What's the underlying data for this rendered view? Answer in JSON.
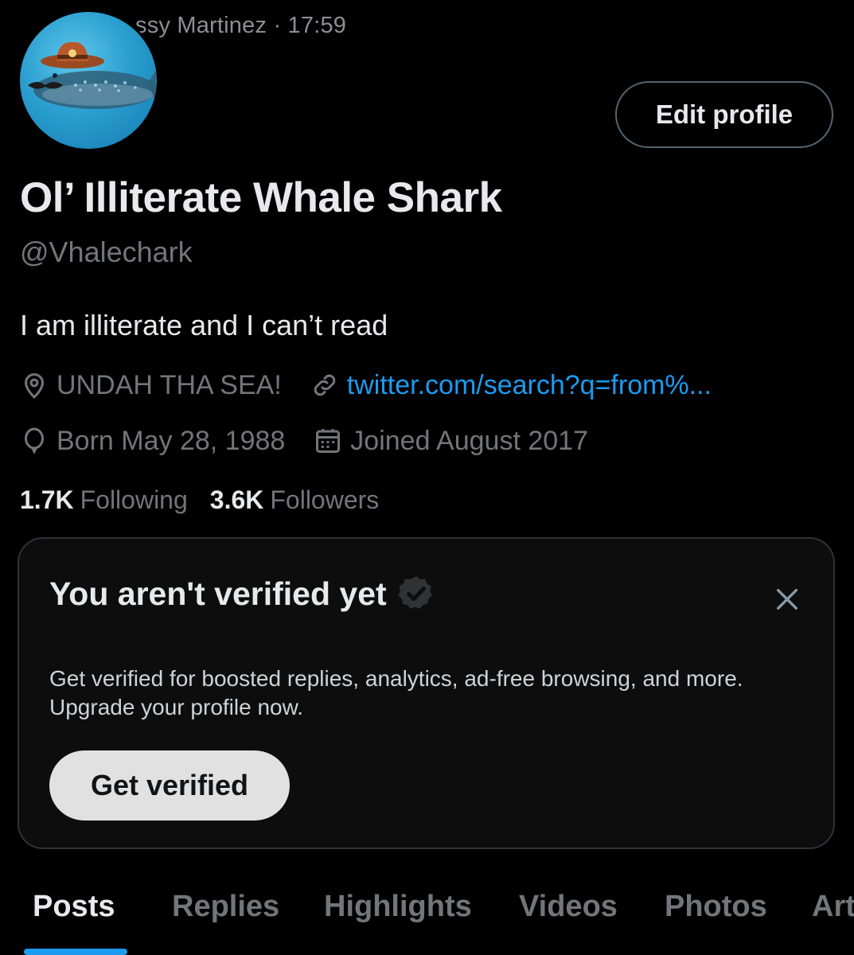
{
  "context": {
    "author": "ssy Martinez",
    "time": "· 17:59"
  },
  "avatar": {
    "alt_icon": "whale-shark-cowboy-avatar"
  },
  "actions": {
    "edit_profile": "Edit profile"
  },
  "profile": {
    "display_name": "Ol’ Illiterate Whale Shark",
    "handle": "@Vhalechark",
    "bio": "I am illiterate and I can’t read",
    "location": "UNDAH THA SEA!",
    "website": "twitter.com/search?q=from%...",
    "birthday": "Born May 28, 1988",
    "joined": "Joined August 2017"
  },
  "stats": {
    "following_count": "1.7K",
    "following_label": "Following",
    "followers_count": "3.6K",
    "followers_label": "Followers"
  },
  "verify_card": {
    "title": "You aren't verified yet",
    "description": "Get verified for boosted replies, analytics, ad-free browsing, and more. Upgrade your profile now.",
    "button": "Get verified"
  },
  "tabs": [
    "Posts",
    "Replies",
    "Highlights",
    "Videos",
    "Photos",
    "Art"
  ],
  "active_tab": "Posts",
  "colors": {
    "background": "#000000",
    "accent": "#1d9bf0",
    "muted_text": "#71767b",
    "primary_text": "#e7e9ea"
  }
}
